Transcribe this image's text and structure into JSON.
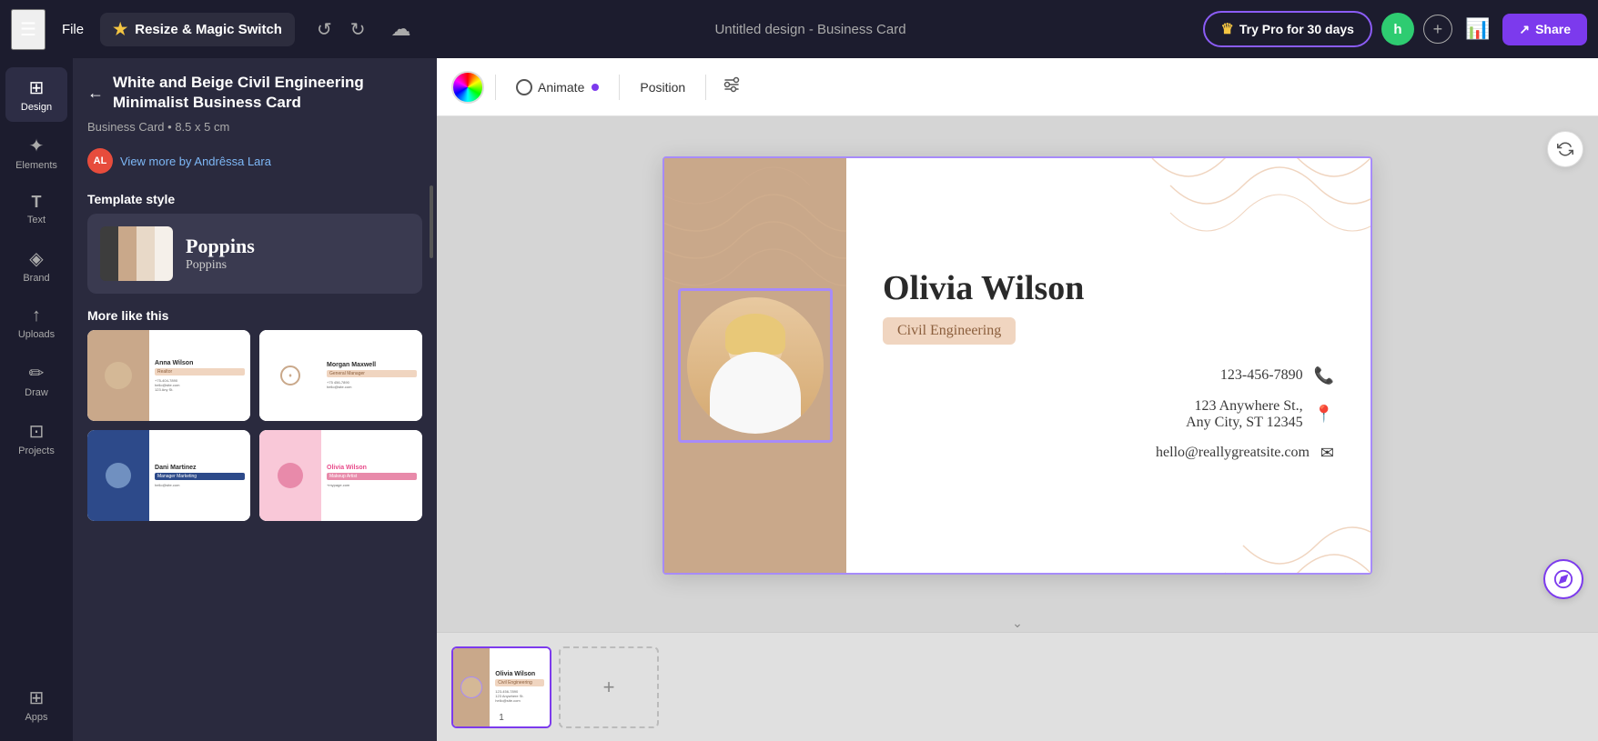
{
  "topbar": {
    "hamburger_label": "☰",
    "file_label": "File",
    "resize_magic_label": "Resize & Magic Switch",
    "undo_label": "↺",
    "redo_label": "↻",
    "cloud_label": "☁",
    "doc_title": "Untitled design - Business Card",
    "try_pro_label": "Try Pro for 30 days",
    "avatar_label": "h",
    "share_label": "Share",
    "share_icon": "↗",
    "chart_icon": "📊"
  },
  "sidebar": {
    "items": [
      {
        "id": "design",
        "icon": "⊞",
        "label": "Design",
        "active": true
      },
      {
        "id": "elements",
        "icon": "✦",
        "label": "Elements",
        "active": false
      },
      {
        "id": "text",
        "icon": "T",
        "label": "Text",
        "active": false
      },
      {
        "id": "brand",
        "icon": "◈",
        "label": "Brand",
        "active": false
      },
      {
        "id": "uploads",
        "icon": "↑",
        "label": "Uploads",
        "active": false
      },
      {
        "id": "draw",
        "icon": "✏",
        "label": "Draw",
        "active": false
      },
      {
        "id": "projects",
        "icon": "⊡",
        "label": "Projects",
        "active": false
      },
      {
        "id": "apps",
        "icon": "⊞",
        "label": "Apps",
        "active": false
      }
    ]
  },
  "left_panel": {
    "back_label": "←",
    "title": "White and Beige Civil Engineering Minimalist Business Card",
    "subtitle": "Business Card • 8.5 x 5 cm",
    "author_initials": "AL",
    "author_link": "View more by Andrêssa Lara",
    "template_style_title": "Template style",
    "template_style": {
      "swatches": [
        "#3d3d3d",
        "#c9a88a",
        "#e8d9c8",
        "#f5f0ea"
      ],
      "font_big": "Poppins",
      "font_small": "Poppins"
    },
    "more_like_title": "More like this",
    "templates": [
      {
        "id": 1,
        "bg": "#f5f0ea",
        "accent": "#c9a88a",
        "name": "Anna Wilson",
        "job": "Realtor"
      },
      {
        "id": 2,
        "bg": "#ffffff",
        "accent": "#c9a88a",
        "name": "Morgan Maxwell",
        "job": "General Manager"
      },
      {
        "id": 3,
        "bg": "#f0f0f0",
        "accent": "#2d4a8a",
        "name": "Dani Martinez",
        "job": "Manager Marketing"
      },
      {
        "id": 4,
        "bg": "#fff0f5",
        "accent": "#e88aaa",
        "name": "Olivia Wilson",
        "job": "Makeup Artist"
      }
    ]
  },
  "canvas_toolbar": {
    "animate_label": "Animate",
    "position_label": "Position",
    "more_options_label": "⚙"
  },
  "business_card": {
    "name": "Olivia Wilson",
    "job_title": "Civil Engineering",
    "phone": "123-456-7890",
    "address_line1": "123 Anywhere St.,",
    "address_line2": "Any City, ST 12345",
    "email": "hello@reallygreatsite.com"
  },
  "filmstrip": {
    "page1_label": "1",
    "add_page_label": "+"
  }
}
